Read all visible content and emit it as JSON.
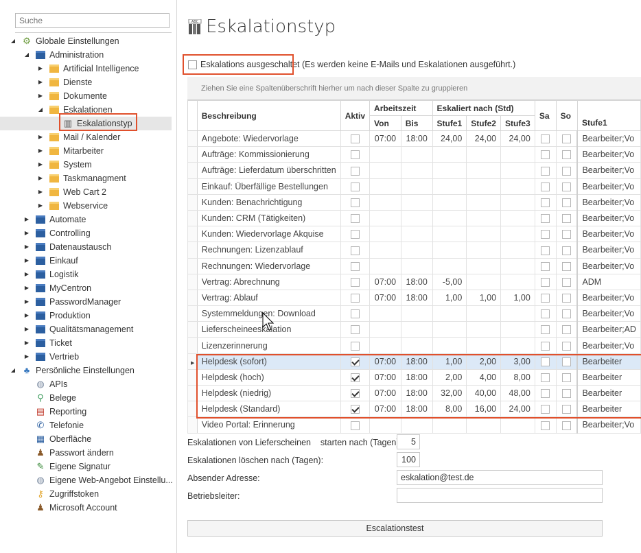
{
  "search": {
    "placeholder": "Suche"
  },
  "tree": [
    {
      "label": "Globale Einstellungen",
      "level": 0,
      "arrow": "open",
      "icon": "gears-icon"
    },
    {
      "label": "Administration",
      "level": 1,
      "arrow": "open",
      "icon": "folder-blue-icon"
    },
    {
      "label": "Artificial Intelligence",
      "level": 2,
      "arrow": "closed",
      "icon": "folder-yellow-icon"
    },
    {
      "label": "Dienste",
      "level": 2,
      "arrow": "closed",
      "icon": "folder-yellow-icon"
    },
    {
      "label": "Dokumente",
      "level": 2,
      "arrow": "closed",
      "icon": "folder-yellow-icon"
    },
    {
      "label": "Eskalationen",
      "level": 2,
      "arrow": "open",
      "icon": "folder-yellow-icon"
    },
    {
      "label": "Eskalationstyp",
      "level": 3,
      "arrow": "",
      "icon": "abc-book-icon",
      "selected": true
    },
    {
      "label": "Mail / Kalender",
      "level": 2,
      "arrow": "closed",
      "icon": "folder-yellow-icon"
    },
    {
      "label": "Mitarbeiter",
      "level": 2,
      "arrow": "closed",
      "icon": "folder-yellow-icon"
    },
    {
      "label": "System",
      "level": 2,
      "arrow": "closed",
      "icon": "folder-yellow-icon"
    },
    {
      "label": "Taskmanagment",
      "level": 2,
      "arrow": "closed",
      "icon": "folder-yellow-icon"
    },
    {
      "label": "Web Cart 2",
      "level": 2,
      "arrow": "closed",
      "icon": "folder-yellow-icon"
    },
    {
      "label": "Webservice",
      "level": 2,
      "arrow": "closed",
      "icon": "folder-yellow-icon"
    },
    {
      "label": "Automate",
      "level": 1,
      "arrow": "closed",
      "icon": "folder-blue-icon"
    },
    {
      "label": "Controlling",
      "level": 1,
      "arrow": "closed",
      "icon": "folder-blue-icon"
    },
    {
      "label": "Datenaustausch",
      "level": 1,
      "arrow": "closed",
      "icon": "folder-blue-icon"
    },
    {
      "label": "Einkauf",
      "level": 1,
      "arrow": "closed",
      "icon": "folder-blue-icon"
    },
    {
      "label": "Logistik",
      "level": 1,
      "arrow": "closed",
      "icon": "folder-blue-icon"
    },
    {
      "label": "MyCentron",
      "level": 1,
      "arrow": "closed",
      "icon": "folder-blue-icon"
    },
    {
      "label": "PasswordManager",
      "level": 1,
      "arrow": "closed",
      "icon": "folder-blue-icon"
    },
    {
      "label": "Produktion",
      "level": 1,
      "arrow": "closed",
      "icon": "folder-blue-icon"
    },
    {
      "label": "Qualitätsmanagement",
      "level": 1,
      "arrow": "closed",
      "icon": "folder-blue-icon"
    },
    {
      "label": "Ticket",
      "level": 1,
      "arrow": "closed",
      "icon": "folder-blue-icon"
    },
    {
      "label": "Vertrieb",
      "level": 1,
      "arrow": "closed",
      "icon": "folder-blue-icon"
    },
    {
      "label": "Persönliche Einstellungen",
      "level": 0,
      "arrow": "open",
      "icon": "user-settings-icon"
    },
    {
      "label": "APIs",
      "level": 1,
      "arrow": "",
      "icon": "globe-icon"
    },
    {
      "label": "Belege",
      "level": 1,
      "arrow": "",
      "icon": "magnifier-icon"
    },
    {
      "label": "Reporting",
      "level": 1,
      "arrow": "",
      "icon": "report-icon"
    },
    {
      "label": "Telefonie",
      "level": 1,
      "arrow": "",
      "icon": "phone-icon"
    },
    {
      "label": "Oberfläche",
      "level": 1,
      "arrow": "",
      "icon": "grid-icon"
    },
    {
      "label": "Passwort ändern",
      "level": 1,
      "arrow": "",
      "icon": "user-key-icon"
    },
    {
      "label": "Eigene Signatur",
      "level": 1,
      "arrow": "",
      "icon": "pen-icon"
    },
    {
      "label": "Eigene Web-Angebot Einstellu...",
      "level": 1,
      "arrow": "",
      "icon": "globe-icon"
    },
    {
      "label": "Zugriffstoken",
      "level": 1,
      "arrow": "",
      "icon": "key-icon"
    },
    {
      "label": "Microsoft Account",
      "level": 1,
      "arrow": "",
      "icon": "user-icon"
    }
  ],
  "page": {
    "title": "Eskalationstyp",
    "title_icon_text": "ABC",
    "esc_disabled_label": "Eskalations ausgeschaltet",
    "esc_disabled_note": "(Es werden keine E-Mails und Eskalationen ausgeführt.)",
    "group_hint": "Ziehen Sie eine Spaltenüberschrift hierher um nach dieser Spalte zu gruppieren"
  },
  "grid": {
    "headers": {
      "beschreibung": "Beschreibung",
      "aktiv": "Aktiv",
      "arbeitszeit": "Arbeitszeit",
      "von": "Von",
      "bis": "Bis",
      "eskaliert": "Eskaliert nach (Std)",
      "stufe1": "Stufe1",
      "stufe2": "Stufe2",
      "stufe3": "Stufe3",
      "sa": "Sa",
      "so": "So",
      "stufe1_user": "Stufe1"
    },
    "rows": [
      {
        "beschreibung": "Angebote: Wiedervorlage",
        "aktiv": false,
        "von": "07:00",
        "bis": "18:00",
        "s1": "24,00",
        "s2": "24,00",
        "s3": "24,00",
        "sa": false,
        "so": false,
        "user": "Bearbeiter;Vo"
      },
      {
        "beschreibung": "Aufträge: Kommissionierung",
        "aktiv": false,
        "von": "",
        "bis": "",
        "s1": "",
        "s2": "",
        "s3": "",
        "sa": false,
        "so": false,
        "user": "Bearbeiter;Vo"
      },
      {
        "beschreibung": "Aufträge: Lieferdatum überschritten",
        "aktiv": false,
        "von": "",
        "bis": "",
        "s1": "",
        "s2": "",
        "s3": "",
        "sa": false,
        "so": false,
        "user": "Bearbeiter;Vo"
      },
      {
        "beschreibung": "Einkauf: Überfällige Bestellungen",
        "aktiv": false,
        "von": "",
        "bis": "",
        "s1": "",
        "s2": "",
        "s3": "",
        "sa": false,
        "so": false,
        "user": "Bearbeiter;Vo"
      },
      {
        "beschreibung": "Kunden: Benachrichtigung",
        "aktiv": false,
        "von": "",
        "bis": "",
        "s1": "",
        "s2": "",
        "s3": "",
        "sa": false,
        "so": false,
        "user": "Bearbeiter;Vo"
      },
      {
        "beschreibung": "Kunden: CRM (Tätigkeiten)",
        "aktiv": false,
        "von": "",
        "bis": "",
        "s1": "",
        "s2": "",
        "s3": "",
        "sa": false,
        "so": false,
        "user": "Bearbeiter;Vo"
      },
      {
        "beschreibung": "Kunden: Wiedervorlage Akquise",
        "aktiv": false,
        "von": "",
        "bis": "",
        "s1": "",
        "s2": "",
        "s3": "",
        "sa": false,
        "so": false,
        "user": "Bearbeiter;Vo"
      },
      {
        "beschreibung": "Rechnungen: Lizenzablauf",
        "aktiv": false,
        "von": "",
        "bis": "",
        "s1": "",
        "s2": "",
        "s3": "",
        "sa": false,
        "so": false,
        "user": "Bearbeiter;Vo"
      },
      {
        "beschreibung": "Rechnungen: Wiedervorlage",
        "aktiv": false,
        "von": "",
        "bis": "",
        "s1": "",
        "s2": "",
        "s3": "",
        "sa": false,
        "so": false,
        "user": "Bearbeiter;Vo"
      },
      {
        "beschreibung": "Vertrag: Abrechnung",
        "aktiv": false,
        "von": "07:00",
        "bis": "18:00",
        "s1": "-5,00",
        "s2": "",
        "s3": "",
        "sa": false,
        "so": false,
        "user": "ADM"
      },
      {
        "beschreibung": "Vertrag: Ablauf",
        "aktiv": false,
        "von": "07:00",
        "bis": "18:00",
        "s1": "1,00",
        "s2": "1,00",
        "s3": "1,00",
        "sa": false,
        "so": false,
        "user": "Bearbeiter;Vo"
      },
      {
        "beschreibung": "Systemmeldungen: Download",
        "aktiv": false,
        "von": "",
        "bis": "",
        "s1": "",
        "s2": "",
        "s3": "",
        "sa": false,
        "so": false,
        "user": "Bearbeiter;Vo"
      },
      {
        "beschreibung": "Lieferscheineeskalation",
        "aktiv": false,
        "von": "",
        "bis": "",
        "s1": "",
        "s2": "",
        "s3": "",
        "sa": false,
        "so": false,
        "user": "Bearbeiter;AD"
      },
      {
        "beschreibung": "Lizenzerinnerung",
        "aktiv": false,
        "von": "",
        "bis": "",
        "s1": "",
        "s2": "",
        "s3": "",
        "sa": false,
        "so": false,
        "user": "Bearbeiter;Vo"
      },
      {
        "beschreibung": "Helpdesk (sofort)",
        "aktiv": true,
        "von": "07:00",
        "bis": "18:00",
        "s1": "1,00",
        "s2": "2,00",
        "s3": "3,00",
        "sa": false,
        "so": false,
        "user": "Bearbeiter",
        "current": true
      },
      {
        "beschreibung": "Helpdesk (hoch)",
        "aktiv": true,
        "von": "07:00",
        "bis": "18:00",
        "s1": "2,00",
        "s2": "4,00",
        "s3": "8,00",
        "sa": false,
        "so": false,
        "user": "Bearbeiter"
      },
      {
        "beschreibung": "Helpdesk (niedrig)",
        "aktiv": true,
        "von": "07:00",
        "bis": "18:00",
        "s1": "32,00",
        "s2": "40,00",
        "s3": "48,00",
        "sa": false,
        "so": false,
        "user": "Bearbeiter"
      },
      {
        "beschreibung": "Helpdesk (Standard)",
        "aktiv": true,
        "von": "07:00",
        "bis": "18:00",
        "s1": "8,00",
        "s2": "16,00",
        "s3": "24,00",
        "sa": false,
        "so": false,
        "user": "Bearbeiter"
      },
      {
        "beschreibung": "Video Portal: Erinnerung",
        "aktiv": false,
        "von": "",
        "bis": "",
        "s1": "",
        "s2": "",
        "s3": "",
        "sa": false,
        "so": false,
        "user": "Bearbeiter;Vo"
      }
    ]
  },
  "form": {
    "liefer_label": "Eskalationen von Lieferscheinen",
    "liefer_label2": "starten nach (Tagen):",
    "liefer_value": "5",
    "loeschen_label": "Eskalationen löschen nach (Tagen):",
    "loeschen_value": "100",
    "absender_label": "Absender Adresse:",
    "absender_value": "eskalation@test.de",
    "betriebsleiter_label": "Betriebsleiter:",
    "betriebsleiter_value": "",
    "test_button": "Escalationstest"
  },
  "colors": {
    "accent_highlight": "#e0502c",
    "folder_blue": "#2c5fa0",
    "folder_yellow": "#f0b640",
    "selected_row": "#dce9f7"
  }
}
